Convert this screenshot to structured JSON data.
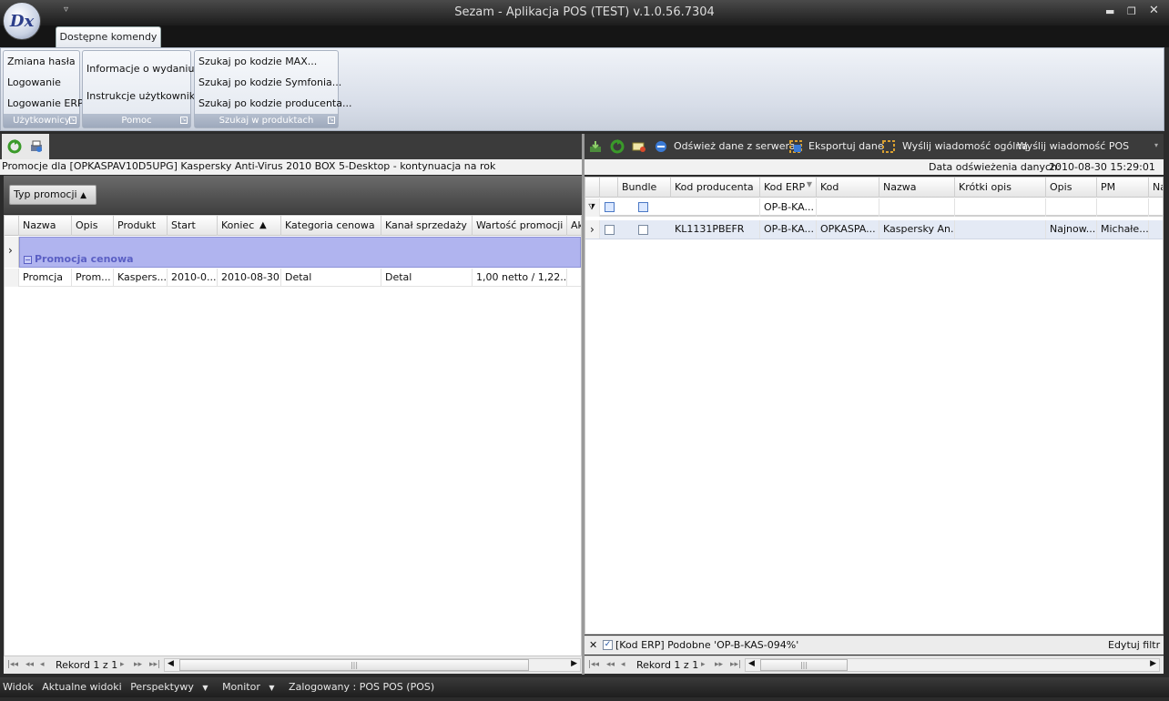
{
  "window": {
    "title": "Sezam - Aplikacja POS (TEST) v.1.0.56.7304",
    "logo_text": "Dx"
  },
  "ribbon": {
    "tab_label": "Dostępne komendy",
    "groups": [
      {
        "caption": "Użytkownicy",
        "items": [
          "Zmiana hasła",
          "Logowanie",
          "Logowanie ERP"
        ]
      },
      {
        "caption": "Pomoc",
        "items": [
          "Informacje o wydaniu",
          "Instrukcje użytkownika"
        ]
      },
      {
        "caption": "Szukaj w produktach",
        "items": [
          "Szukaj po kodzie MAX...",
          "Szukaj po kodzie Symfonia...",
          "Szukaj po kodzie producenta..."
        ]
      }
    ]
  },
  "left_panel": {
    "description": "Promocje dla [OPKASPAV10D5UPG] Kaspersky Anti-Virus 2010 BOX  5-Desktop - kontynuacja na rok",
    "group_chip": "Typ promocji",
    "columns": [
      "Nazwa",
      "Opis",
      "Produkt",
      "Start",
      "Koniec",
      "Kategoria cenowa",
      "Kanał sprzedaży",
      "Wartość promocji",
      "Ak"
    ],
    "group_row": "Promocja cenowa",
    "rows": [
      [
        "Promcja",
        "Prom...",
        "Kaspers...",
        "2010-0...",
        "2010-08-30",
        "Detal",
        "Detal",
        "1,00 netto / 1,22...",
        ""
      ]
    ],
    "pager": "Rekord 1 z 1"
  },
  "right_panel": {
    "toolbar": {
      "refresh_label": "Odśwież dane z serwera",
      "export_label": "Eksportuj dane",
      "send_general_label": "Wyślij wiadomość ogólną",
      "send_pos_label": "Wyślij wiadomość POS"
    },
    "refresh_date_label": "Data odświeżenia danych:",
    "refresh_date_value": "2010-08-30 15:29:01",
    "columns": [
      "Bundle",
      "Kod producenta",
      "Kod ERP",
      "Kod",
      "Nazwa",
      "Krótki opis",
      "Opis",
      "PM",
      "Na"
    ],
    "filter_row": {
      "kod_erp": "OP-B-KA..."
    },
    "rows": [
      [
        "",
        "KL1131PBEFR",
        "OP-B-KA...",
        "OPKASPA...",
        "Kaspersky An...",
        "",
        "Najnow...",
        "Michałe...",
        ""
      ]
    ],
    "filter_text": "[Kod ERP] Podobne 'OP-B-KAS-094%'",
    "edit_filter": "Edytuj filtr",
    "pager": "Rekord 1 z 1"
  },
  "statusbar": {
    "items": [
      "Widok",
      "Aktualne widoki",
      "Perspektywy",
      "Monitor",
      "Zalogowany : POS POS (POS)"
    ]
  }
}
